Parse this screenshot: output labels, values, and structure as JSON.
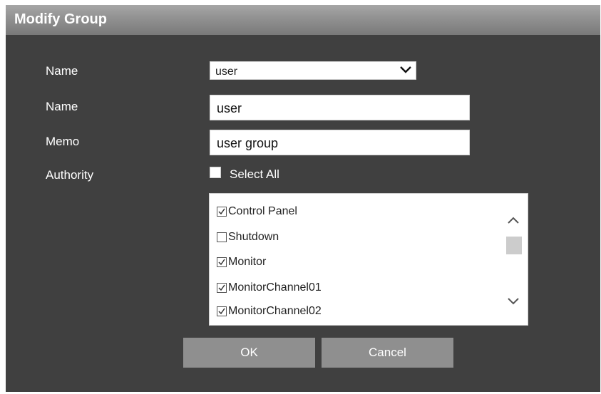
{
  "dialog": {
    "title": "Modify Group"
  },
  "form": {
    "group_select": {
      "label": "Name",
      "value": "user"
    },
    "name": {
      "label": "Name",
      "value": "user"
    },
    "memo": {
      "label": "Memo",
      "value": "user group"
    },
    "authority": {
      "label": "Authority",
      "select_all_label": "Select All",
      "select_all_checked": false,
      "items": [
        {
          "label": "Control Panel",
          "checked": true
        },
        {
          "label": "Shutdown",
          "checked": false
        },
        {
          "label": "Monitor",
          "checked": true
        },
        {
          "label": "MonitorChannel01",
          "checked": true
        },
        {
          "label": "MonitorChannel02",
          "checked": true
        }
      ]
    }
  },
  "buttons": {
    "ok_label": "OK",
    "cancel_label": "Cancel"
  },
  "icons": {
    "dropdown": "chevron-down-icon",
    "scroll_up": "chevron-up-icon",
    "scroll_down": "chevron-down-icon",
    "check": "checkmark-icon"
  },
  "colors": {
    "dialog_bg": "#404040",
    "titlebar": "#8c8c8c",
    "button_bg": "#8f8f8f"
  }
}
